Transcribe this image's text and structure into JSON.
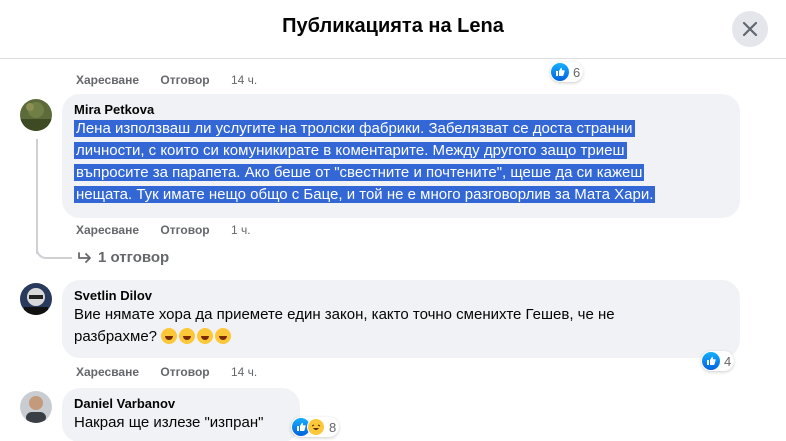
{
  "header": {
    "title": "Публикацията на Lena"
  },
  "colors": {
    "like_blue": "#0866ff",
    "highlight": "#3367d6",
    "bubble_bg": "#f0f2f5",
    "meta_gray": "#65676b"
  },
  "top_actions": {
    "like": "Харесване",
    "reply": "Отговор",
    "time": "14 ч.",
    "reaction_count": "6"
  },
  "comments": [
    {
      "author": "Mira Petkova",
      "lines": [
        "Лена използваш ли услугите на тролски фабрики. Забелязват се доста странни",
        "личности, с които си комуникирате в коментарите. Между другото защо триеш",
        "въпросите за парапета. Ако беше от \"свестните и почтените\", щеше да си кажеш",
        "нещата. Тук имате нещо общо с Баце, и той не е много разговорлив за Мата Хари."
      ],
      "like": "Харесване",
      "reply": "Отговор",
      "time": "1 ч.",
      "replies_label": "1 отговор"
    },
    {
      "author": "Svetlin Dilov",
      "lines": [
        "Вие нямате хора да приемете един закон, както точно сменихте Гешев, че не",
        "разбрахме?"
      ],
      "like": "Харесване",
      "reply": "Отговор",
      "time": "14 ч.",
      "reaction_count": "4",
      "emojis": [
        "rofl-emoji",
        "rofl-emoji",
        "rofl-emoji",
        "rofl-emoji"
      ]
    },
    {
      "author": "Daniel Varbanov",
      "lines": [
        "Накрая ще излезе \"изпран\""
      ],
      "reaction_count": "8"
    }
  ]
}
